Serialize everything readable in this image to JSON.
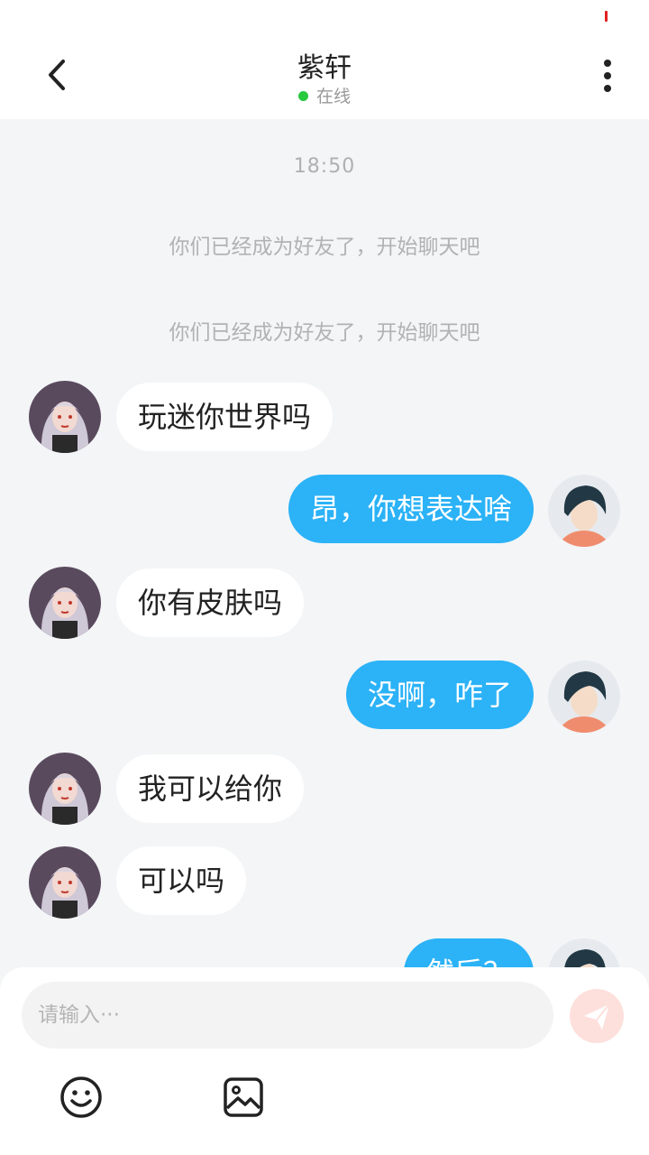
{
  "header": {
    "title": "紫轩",
    "status": "在线"
  },
  "chat": {
    "timestamp": "18:50",
    "system_messages": [
      "你们已经成为好友了，开始聊天吧",
      "你们已经成为好友了，开始聊天吧"
    ],
    "messages": [
      {
        "side": "left",
        "text": "玩迷你世界吗"
      },
      {
        "side": "right",
        "text": "昂，你想表达啥"
      },
      {
        "side": "left",
        "text": "你有皮肤吗"
      },
      {
        "side": "right",
        "text": "没啊，咋了"
      },
      {
        "side": "left",
        "text": "我可以给你"
      },
      {
        "side": "left",
        "text": "可以吗"
      },
      {
        "side": "right",
        "text": "然后？"
      }
    ]
  },
  "composer": {
    "placeholder": "请输入···"
  },
  "icons": {
    "back": "back-arrow-icon",
    "more": "more-vertical-icon",
    "send": "send-icon",
    "emoji": "emoji-icon",
    "image": "image-icon"
  },
  "colors": {
    "accent": "#2bb2f7",
    "online": "#27c93f",
    "send_disabled": "#fde0dc",
    "background": "#f3f5f7"
  }
}
